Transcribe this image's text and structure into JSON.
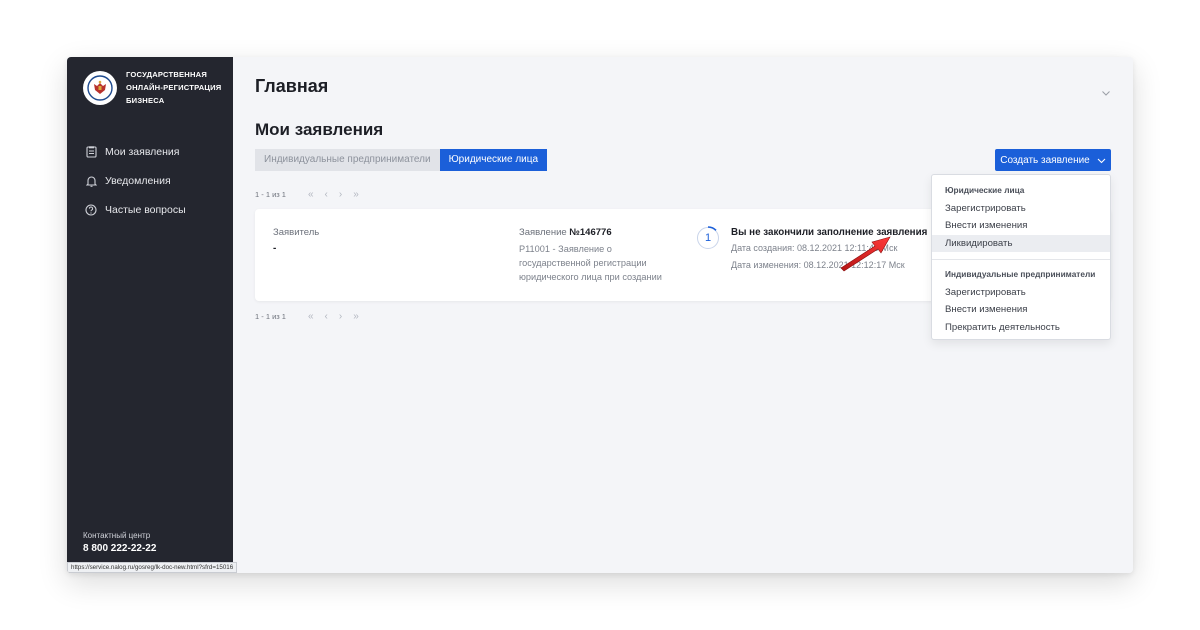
{
  "sidebar": {
    "brand_lines": [
      "ГОСУДАРСТВЕННАЯ",
      "ОНЛАЙН-РЕГИСТРАЦИЯ",
      "БИЗНЕСА"
    ],
    "items": [
      {
        "label": "Мои заявления",
        "icon": "document-icon"
      },
      {
        "label": "Уведомления",
        "icon": "bell-icon"
      },
      {
        "label": "Частые вопросы",
        "icon": "help-circle-icon"
      }
    ],
    "contact_label": "Контактный центр",
    "contact_phone": "8 800 222-22-22"
  },
  "status_bar": {
    "url": "https://service.nalog.ru/gosreg/lk-doc-new.html?sfrd=15016"
  },
  "header": {
    "title": "Главная"
  },
  "main": {
    "section_title": "Мои заявления",
    "tabs": [
      {
        "label": "Индивидуальные предприниматели",
        "active": false
      },
      {
        "label": "Юридические лица",
        "active": true
      }
    ],
    "pager_top": {
      "count": "1 - 1 из 1",
      "first": "«",
      "prev": "‹",
      "next": "›",
      "last": "»"
    },
    "pager_bottom": {
      "count": "1 - 1 из 1",
      "first": "«",
      "prev": "‹",
      "next": "›",
      "last": "»"
    },
    "create_button": "Создать заявление",
    "card": {
      "applicant_label": "Заявитель",
      "applicant_value": "-",
      "application_label": "Заявление",
      "application_number": "№146776",
      "application_desc": "Р11001 - Заявление о государственной регистрации юридического лица при создании",
      "step": "1",
      "status_title": "Вы не закончили заполнение заявления",
      "created": "Дата создания: 08.12.2021 12:11:49 Мск",
      "modified": "Дата изменения: 08.12.2021 12:12:17 Мск"
    },
    "dropdown": {
      "groups": [
        {
          "title": "Юридические лица",
          "items": [
            "Зарегистрировать",
            "Внести изменения",
            "Ликвидировать"
          ]
        },
        {
          "title": "Индивидуальные предприниматели",
          "items": [
            "Зарегистрировать",
            "Внести изменения",
            "Прекратить деятельность"
          ]
        }
      ],
      "hovered_item": "Ликвидировать"
    }
  },
  "colors": {
    "sidebar": "#24262f",
    "accent": "#1b5fd9",
    "background": "#f4f5f8",
    "annotation_arrow": "#e02020"
  }
}
